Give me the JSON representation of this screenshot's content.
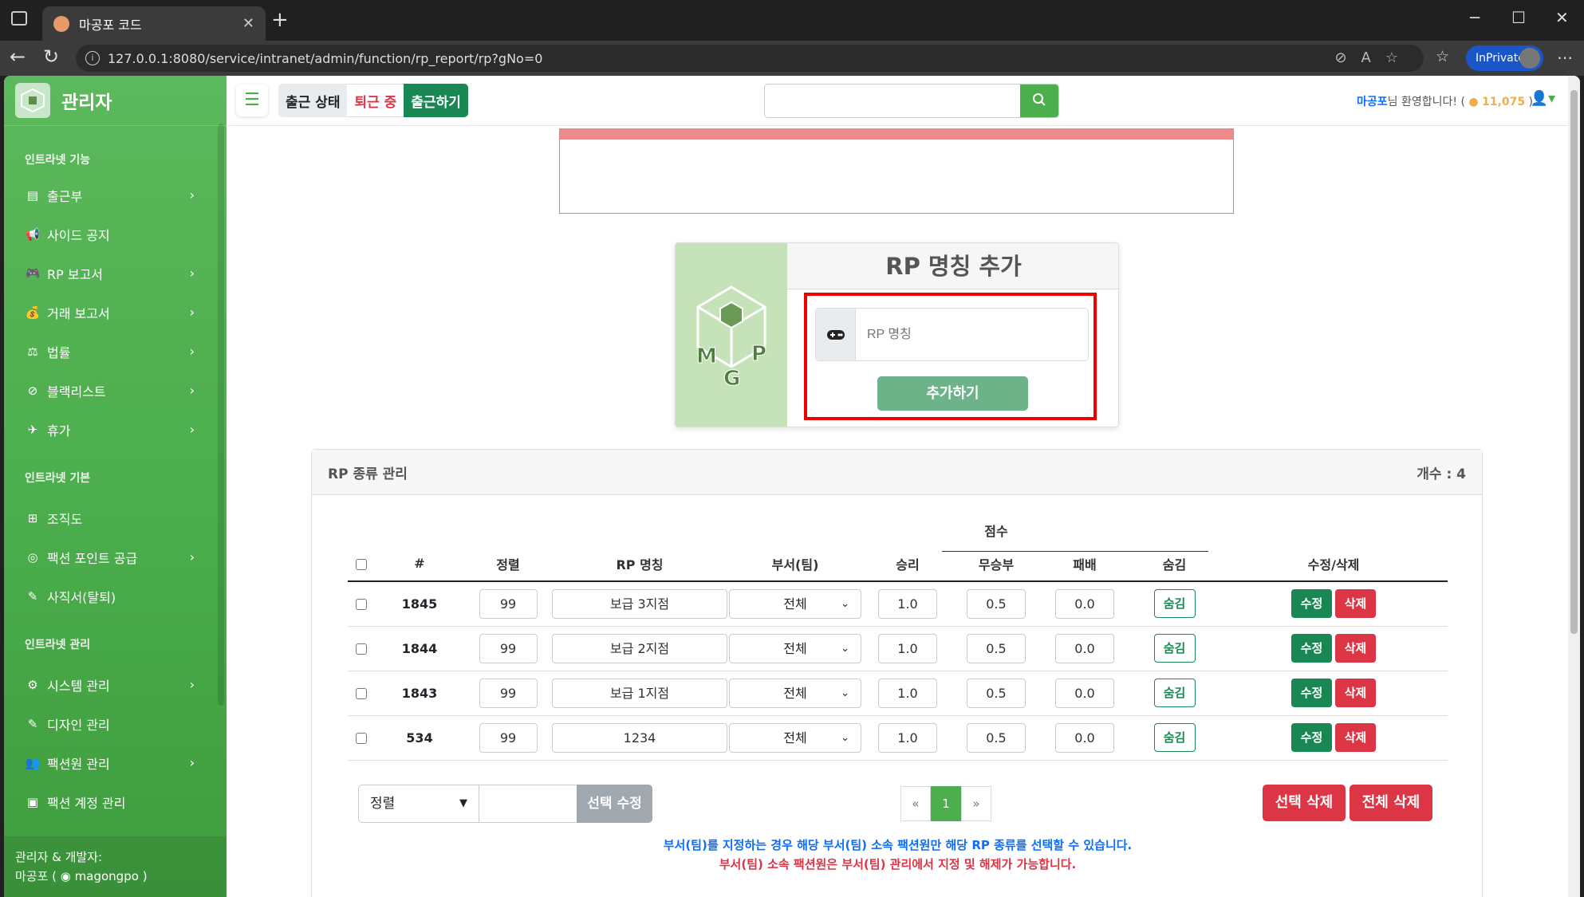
{
  "browser": {
    "tab_title": "마공포 코드",
    "url": "127.0.0.1:8080/service/intranet/admin/function/rp_report/rp?gNo=0",
    "inprivate": "InPrivate"
  },
  "sidebar": {
    "brand": "관리자",
    "sections": [
      {
        "title": "인트라넷 기능",
        "items": [
          {
            "label": "출근부",
            "icon": "book-icon",
            "chevron": true
          },
          {
            "label": "사이드 공지",
            "icon": "megaphone-icon",
            "chevron": false
          },
          {
            "label": "RP 보고서",
            "icon": "gamepad-icon",
            "chevron": true
          },
          {
            "label": "거래 보고서",
            "icon": "moneybag-icon",
            "chevron": true
          },
          {
            "label": "법률",
            "icon": "scale-icon",
            "chevron": true
          },
          {
            "label": "블랙리스트",
            "icon": "ban-icon",
            "chevron": true
          },
          {
            "label": "휴가",
            "icon": "plane-icon",
            "chevron": true
          }
        ]
      },
      {
        "title": "인트라넷 기본",
        "items": [
          {
            "label": "조직도",
            "icon": "sitemap-icon",
            "chevron": false
          },
          {
            "label": "팩션 포인트 공급",
            "icon": "coins-icon",
            "chevron": true
          },
          {
            "label": "사직서(탈퇴)",
            "icon": "pen-icon",
            "chevron": false
          }
        ]
      },
      {
        "title": "인트라넷 관리",
        "items": [
          {
            "label": "시스템 관리",
            "icon": "gear-icon",
            "chevron": true
          },
          {
            "label": "디자인 관리",
            "icon": "brush-icon",
            "chevron": false
          },
          {
            "label": "팩션원 관리",
            "icon": "user-gear-icon",
            "chevron": true
          },
          {
            "label": "팩션 계정 관리",
            "icon": "id-card-icon",
            "chevron": false
          }
        ]
      }
    ],
    "footer_line1": "관리자 & 개발자:",
    "footer_line2": "마공포 ( ",
    "footer_discord": "magongpo",
    "footer_close": " )"
  },
  "topbar": {
    "attendance_label": "출근 상태",
    "attendance_status": "퇴근 중",
    "attendance_button": "출근하기",
    "search_placeholder": "",
    "welcome_user": "마공포",
    "welcome_text": "님 환영합니다! (",
    "points": "11,075",
    "welcome_close": ")"
  },
  "add_card": {
    "title": "RP 명칭 추가",
    "input_placeholder": "RP 명칭",
    "submit": "추가하기"
  },
  "panel": {
    "title": "RP 종류 관리",
    "count": "개수 : 4",
    "headers": {
      "score_group": "점수",
      "num": "#",
      "sort": "정렬",
      "name": "RP 명칭",
      "dept": "부서(팀)",
      "win": "승리",
      "draw": "무승부",
      "loss": "패배",
      "hide": "숨김",
      "edit_delete": "수정/삭제"
    },
    "rows": [
      {
        "id": "1845",
        "sort": "99",
        "name": "보급 3지점",
        "dept": "전체",
        "win": "1.0",
        "draw": "0.5",
        "loss": "0.0",
        "hide": "숨김",
        "edit": "수정",
        "del": "삭제"
      },
      {
        "id": "1844",
        "sort": "99",
        "name": "보급 2지점",
        "dept": "전체",
        "win": "1.0",
        "draw": "0.5",
        "loss": "0.0",
        "hide": "숨김",
        "edit": "수정",
        "del": "삭제"
      },
      {
        "id": "1843",
        "sort": "99",
        "name": "보급 1지점",
        "dept": "전체",
        "win": "1.0",
        "draw": "0.5",
        "loss": "0.0",
        "hide": "숨김",
        "edit": "수정",
        "del": "삭제"
      },
      {
        "id": "534",
        "sort": "99",
        "name": "1234",
        "dept": "전체",
        "win": "1.0",
        "draw": "0.5",
        "loss": "0.0",
        "hide": "숨김",
        "edit": "수정",
        "del": "삭제"
      }
    ],
    "bulk_select": "정렬",
    "bulk_modify": "선택 수정",
    "pager": {
      "prev": "«",
      "current": "1",
      "next": "»"
    },
    "delete_selected": "선택 삭제",
    "delete_all": "전체 삭제",
    "note1": "부서(팀)를 지정하는 경우 해당 부서(팀) 소속 팩션원만 해당 RP 종류를 선택할 수 있습니다.",
    "note2": "부서(팀) 소속 팩션원은 부서(팀) 관리에서 지정 및 해제가 가능합니다."
  },
  "colors": {
    "sidebar": "#4cae4c",
    "success": "#198754",
    "danger": "#dc3545",
    "highlight": "#ee0000"
  }
}
